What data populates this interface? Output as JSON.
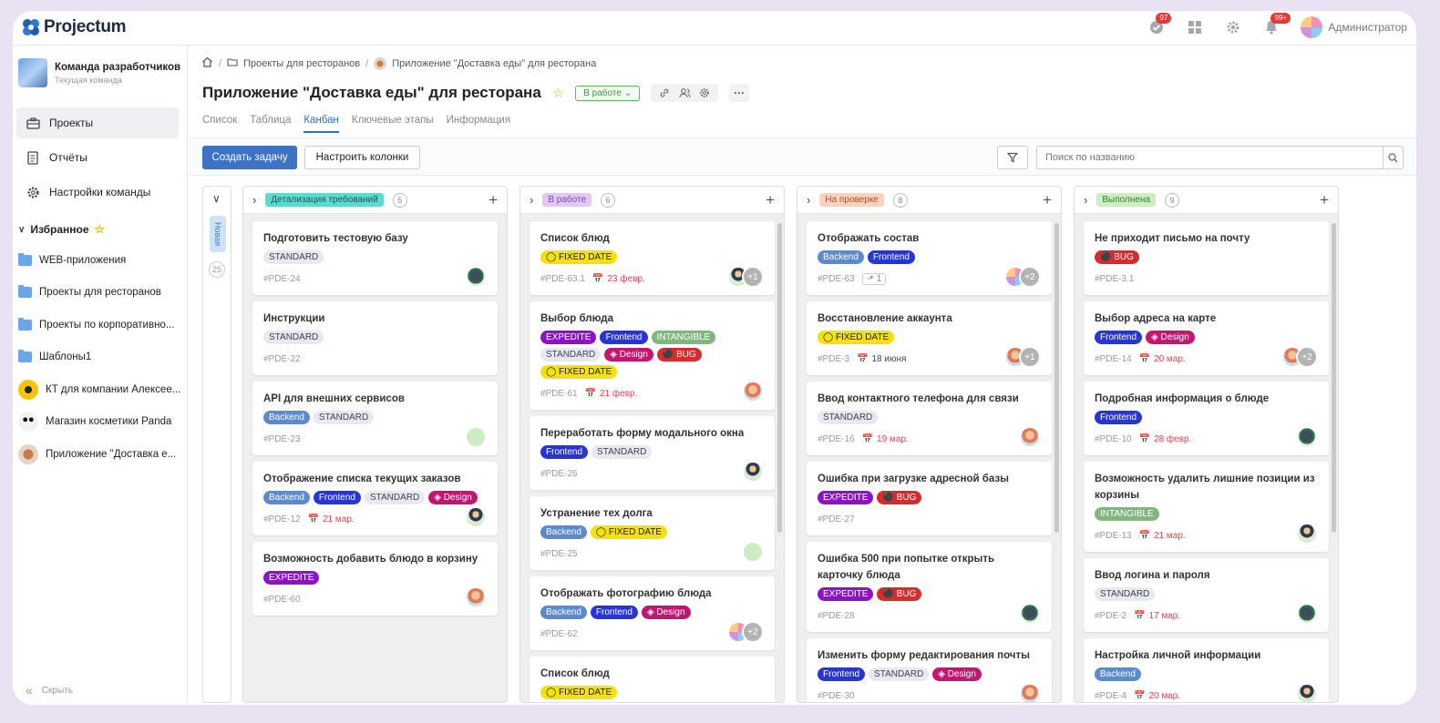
{
  "app": {
    "name": "Projectum"
  },
  "topbar": {
    "tasks_badge": "97",
    "notif_badge": "99+",
    "user_name": "Администратор",
    "icons": [
      "check-circle-icon",
      "grid-icon",
      "gear-icon",
      "bell-icon"
    ]
  },
  "sidebar": {
    "team_name": "Команда разработчиков",
    "team_sub": "Текущая команда",
    "nav": [
      {
        "label": "Проекты",
        "icon": "briefcase-icon"
      },
      {
        "label": "Отчёты",
        "icon": "report-icon"
      },
      {
        "label": "Настройки команды",
        "icon": "gear-icon"
      }
    ],
    "favorites_label": "Избранное",
    "favorites": [
      {
        "label": "WEB-приложения",
        "icon": "folder-icon"
      },
      {
        "label": "Проекты для ресторанов",
        "icon": "folder-icon"
      },
      {
        "label": "Проекты по корпоративно...",
        "icon": "folder-icon"
      },
      {
        "label": "Шаблоны1",
        "icon": "folder-icon"
      },
      {
        "label": "КТ для компании Алексее...",
        "icon": "taxi-avatar"
      },
      {
        "label": "Магазин косметики Panda",
        "icon": "panda-avatar"
      },
      {
        "label": "Приложение \"Доставка е...",
        "icon": "food-avatar"
      }
    ],
    "collapse_label": "Скрыть"
  },
  "breadcrumbs": [
    "Проекты для ресторанов",
    "Приложение \"Доставка еды\" для ресторана"
  ],
  "project": {
    "title": "Приложение \"Доставка еды\" для ресторана",
    "status": "В работе"
  },
  "tabs": [
    "Список",
    "Таблица",
    "Канбан",
    "Ключевые этапы",
    "Информация"
  ],
  "active_tab": "Канбан",
  "toolbar": {
    "create_label": "Создать задачу",
    "configure_label": "Настроить колонки",
    "search_placeholder": "Поиск по названию"
  },
  "colors": {
    "accent": "#3d72c4",
    "link": "#2a6fd6"
  },
  "board": {
    "new_column": {
      "label": "Новая",
      "count": "25"
    },
    "columns": [
      {
        "name": "Детализация требований",
        "count": "5",
        "tag_bg": "#5fd8cf",
        "tag_fg": "#1c5a55",
        "cards": [
          {
            "title": "Подготовить тестовую базу",
            "tags": [
              [
                "STANDARD",
                "std"
              ]
            ],
            "id": "#PDE-24",
            "avatars": [
              "hacker"
            ]
          },
          {
            "title": "Инструкции",
            "tags": [
              [
                "STANDARD",
                "std"
              ]
            ],
            "id": "#PDE-22",
            "avatars": []
          },
          {
            "title": "API для внешних сервисов",
            "tags": [
              [
                "Backend",
                "back"
              ],
              [
                "STANDARD",
                "std"
              ]
            ],
            "id": "#PDE-23",
            "avatars": [
              "green"
            ]
          },
          {
            "title": "Отображение списка текущих заказов",
            "tags": [
              [
                "Backend",
                "back"
              ],
              [
                "Frontend",
                "front"
              ],
              [
                "STANDARD",
                "std"
              ],
              [
                "Design",
                "des"
              ]
            ],
            "id": "#PDE-12",
            "due": "21 мар.",
            "avatars": [
              "dev"
            ]
          },
          {
            "title": "Возможность добавить блюдо в корзину",
            "tags": [
              [
                "EXPEDITE",
                "exp"
              ]
            ],
            "id": "#PDE-60",
            "avatars": [
              "woman"
            ]
          }
        ]
      },
      {
        "name": "В работе",
        "count": "6",
        "tag_bg": "#e2c8f5",
        "tag_fg": "#7a4a9e",
        "cards": [
          {
            "title": "Список блюд",
            "tags": [
              [
                "FIXED DATE",
                "fix"
              ]
            ],
            "id": "#PDE-63.1",
            "due": "23 февр.",
            "avatars": [
              "dev"
            ],
            "more": "+1"
          },
          {
            "title": "Выбор блюда",
            "tags": [
              [
                "EXPEDITE",
                "exp"
              ],
              [
                "Frontend",
                "front"
              ],
              [
                "INTANGIBLE",
                "int"
              ],
              [
                "STANDARD",
                "std"
              ],
              [
                "Design",
                "des"
              ],
              [
                "BUG",
                "bug"
              ],
              [
                "FIXED DATE",
                "fix"
              ]
            ],
            "id": "#PDE-61",
            "due": "21 февр.",
            "avatars": [
              "woman"
            ]
          },
          {
            "title": "Переработать форму модального окна",
            "tags": [
              [
                "Frontend",
                "front"
              ],
              [
                "STANDARD",
                "std"
              ]
            ],
            "id": "#PDE-26",
            "avatars": [
              "dev"
            ]
          },
          {
            "title": "Устранение тех долга",
            "tags": [
              [
                "Backend",
                "back"
              ],
              [
                "FIXED DATE",
                "fix"
              ]
            ],
            "id": "#PDE-25",
            "avatars": [
              "green"
            ]
          },
          {
            "title": "Отображать фотографию блюда",
            "tags": [
              [
                "Backend",
                "back"
              ],
              [
                "Frontend",
                "front"
              ],
              [
                "Design",
                "des"
              ]
            ],
            "id": "#PDE-62",
            "avatars": [
              "multi"
            ],
            "more": "+2"
          },
          {
            "title": "Список блюд",
            "tags": [
              [
                "FIXED DATE",
                "fix"
              ]
            ],
            "id": "",
            "avatars": []
          }
        ]
      },
      {
        "name": "На проверке",
        "count": "8",
        "tag_bg": "#fbd2bd",
        "tag_fg": "#a2532b",
        "cards": [
          {
            "title": "Отображать состав",
            "tags": [
              [
                "Backend",
                "back"
              ],
              [
                "Frontend",
                "front"
              ]
            ],
            "id": "#PDE-63",
            "sub": "1",
            "avatars": [
              "multi"
            ],
            "more": "+2"
          },
          {
            "title": "Восстановление аккаунта",
            "tags": [
              [
                "FIXED DATE",
                "fix"
              ]
            ],
            "id": "#PDE-3",
            "due_gray": "18 июня",
            "avatars": [
              "woman"
            ],
            "more": "+1"
          },
          {
            "title": "Ввод контактного телефона для связи",
            "tags": [
              [
                "STANDARD",
                "std"
              ]
            ],
            "id": "#PDE-16",
            "due": "19 мар.",
            "avatars": [
              "woman"
            ]
          },
          {
            "title": "Ошибка при загрузке адресной базы",
            "tags": [
              [
                "EXPEDITE",
                "exp"
              ],
              [
                "BUG",
                "bug"
              ]
            ],
            "id": "#PDE-27",
            "avatars": []
          },
          {
            "title": "Ошибка 500 при попытке открыть карточку блюда",
            "tags": [
              [
                "EXPEDITE",
                "exp"
              ],
              [
                "BUG",
                "bug"
              ]
            ],
            "id": "#PDE-28",
            "avatars": [
              "hacker"
            ]
          },
          {
            "title": "Изменить форму редактирования почты",
            "tags": [
              [
                "Frontend",
                "front"
              ],
              [
                "STANDARD",
                "std"
              ],
              [
                "Design",
                "des"
              ]
            ],
            "id": "#PDE-30",
            "avatars": [
              "woman"
            ]
          }
        ]
      },
      {
        "name": "Выполнена",
        "count": "9",
        "tag_bg": "#cdeec3",
        "tag_fg": "#3a7a2e",
        "cards": [
          {
            "title": "Не приходит письмо на почту",
            "tags": [
              [
                "BUG",
                "bug"
              ]
            ],
            "id": "#PDE-3.1",
            "avatars": []
          },
          {
            "title": "Выбор адреса на карте",
            "tags": [
              [
                "Frontend",
                "front"
              ],
              [
                "Design",
                "des"
              ]
            ],
            "id": "#PDE-14",
            "due": "20 мар.",
            "avatars": [
              "woman"
            ],
            "more": "+2"
          },
          {
            "title": "Подробная информация о блюде",
            "tags": [
              [
                "Frontend",
                "front"
              ]
            ],
            "id": "#PDE-10",
            "due": "28 февр.",
            "avatars": [
              "hacker"
            ]
          },
          {
            "title": "Возможность удалить лишние позиции из корзины",
            "tags": [
              [
                "INTANGIBLE",
                "int"
              ]
            ],
            "id": "#PDE-13",
            "due": "21 мар.",
            "avatars": [
              "dev"
            ]
          },
          {
            "title": "Ввод логина и пароля",
            "tags": [
              [
                "STANDARD",
                "std"
              ]
            ],
            "id": "#PDE-2",
            "due": "17 мар.",
            "avatars": [
              "hacker"
            ]
          },
          {
            "title": "Настройка личной информации",
            "tags": [
              [
                "Backend",
                "back"
              ]
            ],
            "id": "#PDE-4",
            "due": "20 мар.",
            "avatars": [
              "dev"
            ]
          }
        ]
      }
    ]
  }
}
